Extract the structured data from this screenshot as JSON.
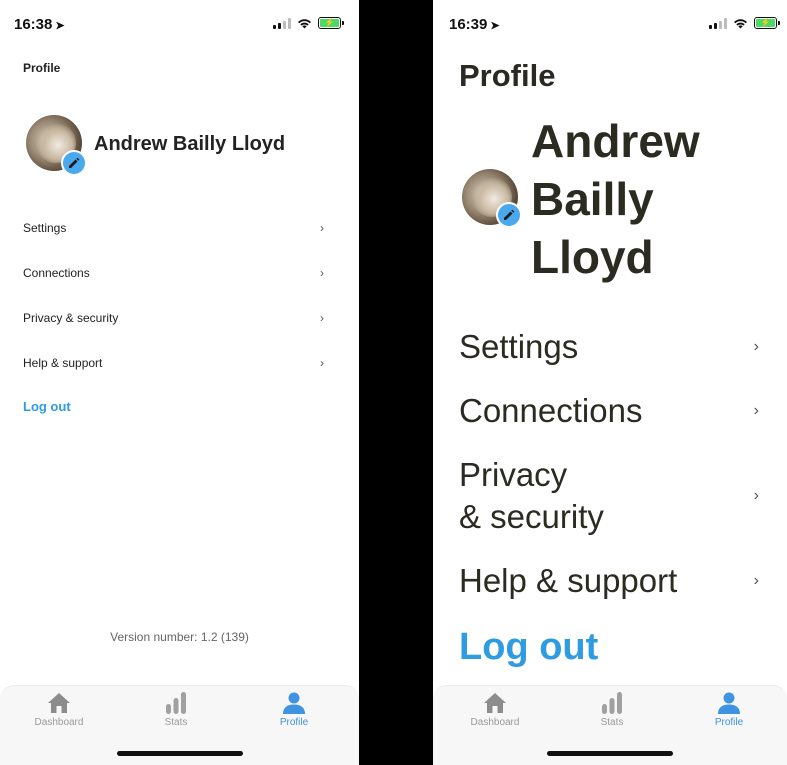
{
  "left": {
    "time": "16:38",
    "title": "Profile",
    "name": "Andrew Bailly Lloyd",
    "menu": [
      "Settings",
      "Connections",
      "Privacy & security",
      "Help & support"
    ],
    "logout": "Log out",
    "version": "Version number: 1.2 (139)"
  },
  "right": {
    "time": "16:39",
    "title": "Profile",
    "name_lines": [
      "Andrew",
      "Bailly",
      "Lloyd"
    ],
    "menu": [
      "Settings",
      "Connections",
      "Privacy",
      "& security",
      "Help & support"
    ],
    "logout": "Log out"
  },
  "tabs": [
    "Dashboard",
    "Stats",
    "Profile"
  ],
  "colors": {
    "accent": "#2f9be0",
    "active_tab": "#3e94e0",
    "battery": "#4cd964"
  }
}
